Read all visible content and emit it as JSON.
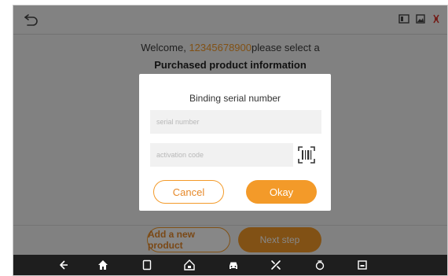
{
  "header": {
    "back_icon": "undo-arrow-icon",
    "status_icons": [
      "vci-icon",
      "image-icon",
      "disconnected-icon"
    ]
  },
  "welcome": {
    "prefix": "Welcome,",
    "phone": "12345678900",
    "suffix": "please select a"
  },
  "heading": "Purchased product information",
  "footer": {
    "add_product_label": "Add a new product",
    "next_step_label": "Next step"
  },
  "dialog": {
    "title": "Binding serial number",
    "serial_placeholder": "serial number",
    "activation_placeholder": "activation code",
    "cancel_label": "Cancel",
    "okay_label": "Okay"
  },
  "navbar": {
    "icons": [
      "back-icon",
      "home-icon",
      "recent-apps-icon",
      "diagnose-home-icon",
      "car-icon",
      "tools-icon",
      "screenshot-icon",
      "gallery-icon"
    ]
  },
  "colors": {
    "accent": "#f39a29",
    "navbar": "#1e1e1e"
  }
}
